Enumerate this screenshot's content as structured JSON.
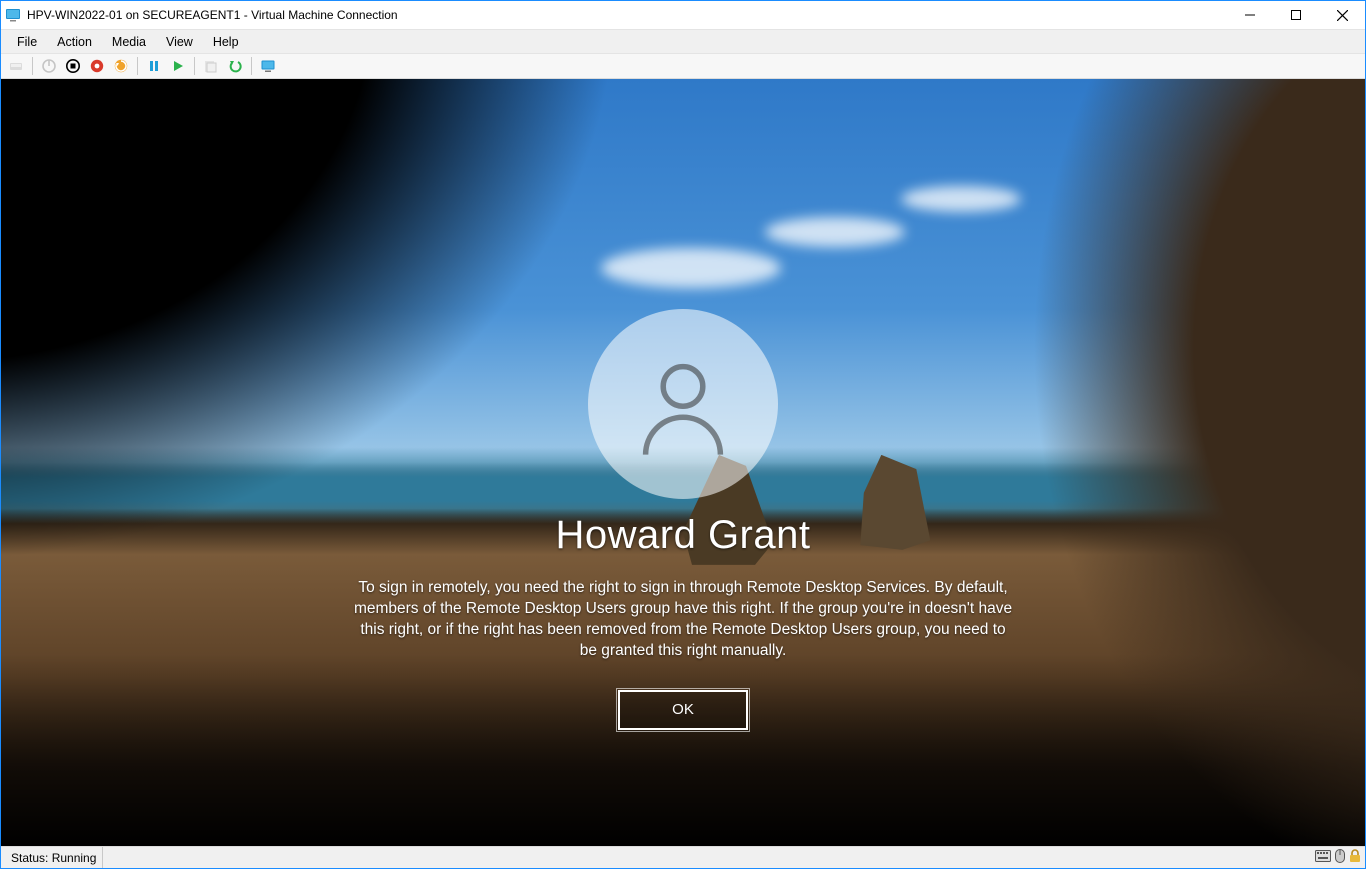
{
  "window": {
    "title": "HPV-WIN2022-01 on SECUREAGENT1 - Virtual Machine Connection"
  },
  "menubar": {
    "items": [
      "File",
      "Action",
      "Media",
      "View",
      "Help"
    ]
  },
  "toolbar": {
    "icons": [
      "ctrl-alt-del-icon",
      "power-off-icon",
      "turn-off-icon",
      "shutdown-icon",
      "reset-icon",
      "pause-icon",
      "start-icon",
      "checkpoint-icon",
      "revert-icon",
      "enhanced-session-icon"
    ]
  },
  "login": {
    "username": "Howard Grant",
    "message": "To sign in remotely, you need the right to sign in through Remote Desktop Services. By default, members of the Remote Desktop Users group have this right. If the group you're in doesn't have this right, or if the right has been removed from the Remote Desktop Users group, you need to be granted this right manually.",
    "ok_label": "OK"
  },
  "statusbar": {
    "text": "Status: Running"
  }
}
